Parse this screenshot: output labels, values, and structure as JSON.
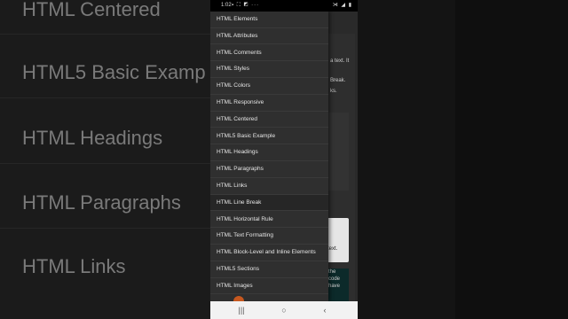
{
  "background": {
    "items": [
      "HTML Centered",
      "HTML5 Basic Examp",
      "HTML Headings",
      "HTML Paragraphs",
      "HTML Links"
    ]
  },
  "statusbar": {
    "time": "1:02",
    "left_icons": "▪ ⛶ ◩ ···",
    "right_icons": "⋊ ◢ ▮"
  },
  "page": {
    "fragments": [
      "a text. It",
      "Break.",
      "ks."
    ],
    "card_text": "text.",
    "code_lines": [
      "the",
      "code",
      "have"
    ]
  },
  "menu": {
    "items": [
      {
        "label": "HTML Elements"
      },
      {
        "label": "HTML Attributes"
      },
      {
        "label": "HTML Comments"
      },
      {
        "label": "HTML Styles"
      },
      {
        "label": "HTML Colors"
      },
      {
        "label": "HTML Responsive"
      },
      {
        "label": "HTML Centered"
      },
      {
        "label": "HTML5 Basic Example"
      },
      {
        "label": "HTML Headings"
      },
      {
        "label": "HTML Paragraphs"
      },
      {
        "label": "HTML Links"
      },
      {
        "label": "HTML Line Break",
        "active": true
      },
      {
        "label": "HTML Horizontal Rule"
      },
      {
        "label": "HTML Text Formatting"
      },
      {
        "label": "HTML Block-Level and Inline Elements"
      },
      {
        "label": "HTML5 Sections"
      },
      {
        "label": "HTML Images"
      }
    ]
  },
  "navbar": {
    "recent": "|||",
    "home": "○",
    "back": "‹"
  },
  "colors": {
    "menu_bg": "#2f2f2f",
    "fab": "#c7581f",
    "navbar_bg": "#f2f2f2"
  }
}
